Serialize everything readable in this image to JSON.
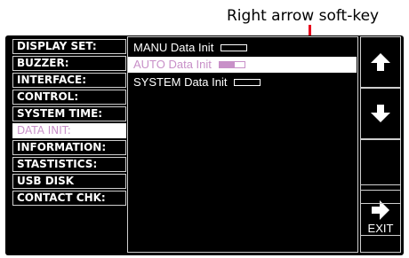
{
  "callout": {
    "label": "Right arrow soft-key"
  },
  "menu": {
    "items": [
      {
        "label": "DISPLAY SET:",
        "selected": false
      },
      {
        "label": "BUZZER:",
        "selected": false
      },
      {
        "label": "INTERFACE:",
        "selected": false
      },
      {
        "label": "CONTROL:",
        "selected": false
      },
      {
        "label": "SYSTEM TIME:",
        "selected": false
      },
      {
        "label": "DATA INIT:",
        "selected": true
      },
      {
        "label": "INFORMATION:",
        "selected": false
      },
      {
        "label": "STASTISTICS:",
        "selected": false
      },
      {
        "label": "USB DISK",
        "selected": false
      },
      {
        "label": "CONTACT CHK:",
        "selected": false
      }
    ]
  },
  "options": [
    {
      "label": "MANU Data Init",
      "selected": false,
      "fill": 0.0
    },
    {
      "label": "AUTO Data Init",
      "selected": true,
      "fill": 0.6
    },
    {
      "label": "SYSTEM Data Init",
      "selected": false,
      "fill": 0.0
    }
  ],
  "softkeys": {
    "up_icon": "up-arrow-icon",
    "down_icon": "down-arrow-icon",
    "right_icon": "right-arrow-icon",
    "exit_label": "EXIT"
  },
  "colors": {
    "screen_bg": "#000000",
    "text": "#ffffff",
    "highlight_text": "#c890c8",
    "callout_arrow": "#e8001c"
  }
}
